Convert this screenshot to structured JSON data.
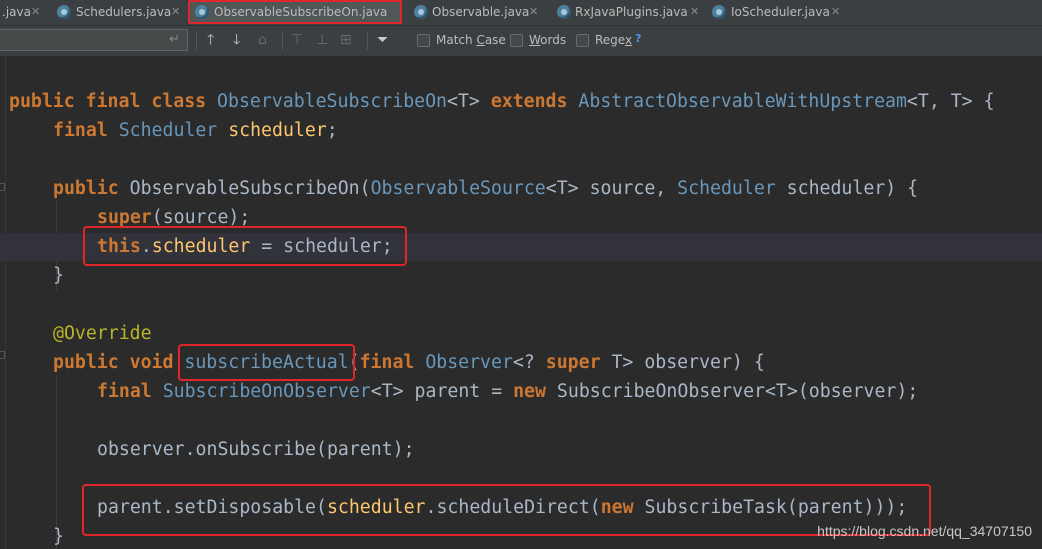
{
  "tabs": [
    {
      "label": ".java",
      "active": false,
      "icon": "java-class-icon"
    },
    {
      "label": "Schedulers.java",
      "active": false,
      "icon": "java-class-icon"
    },
    {
      "label": "ObservableSubscribeOn.java",
      "active": true,
      "icon": "java-class-icon"
    },
    {
      "label": "Observable.java",
      "active": false,
      "icon": "java-class-icon"
    },
    {
      "label": "RxJavaPlugins.java",
      "active": false,
      "icon": "java-class-icon"
    },
    {
      "label": "IoScheduler.java",
      "active": false,
      "icon": "java-class-icon"
    }
  ],
  "tab_close_glyph": "✕",
  "search": {
    "value": "",
    "placeholder": "",
    "options": [
      {
        "label_pre": "Match ",
        "label_u": "C",
        "label_post": "ase",
        "checked": false
      },
      {
        "label_pre": "",
        "label_u": "W",
        "label_post": "ords",
        "checked": false
      },
      {
        "label_pre": "Rege",
        "label_u": "x",
        "label_post": "",
        "checked": false
      }
    ],
    "help": "?"
  },
  "code": {
    "l1": {
      "t1": "public final class ",
      "t2": "ObservableSubscribeOn",
      "t3": "<T> ",
      "t4": "extends ",
      "t5": "AbstractObservableWithUpstream",
      "t6": "<T, T> {"
    },
    "l2": {
      "t1": "final ",
      "t2": "Scheduler ",
      "t3": "scheduler",
      "t4": ";"
    },
    "l3": {
      "t1": "public ",
      "t2": "ObservableSubscribeOn(",
      "t3": "ObservableSource",
      "t4": "<T> source, ",
      "t5": "Scheduler ",
      "t6": "scheduler) {"
    },
    "l4": {
      "t1": "super",
      "t2": "(source);"
    },
    "l5": {
      "t1": "this",
      "t2": ".",
      "t3": "scheduler",
      "t4": " = scheduler;"
    },
    "l6": {
      "t1": "}"
    },
    "l7": {
      "t1": "@Override"
    },
    "l8": {
      "t1": "public void ",
      "t2": "subscribeActual",
      "t3": "(",
      "t4": "final ",
      "t5": "Observer",
      "t6": "<? ",
      "t7": "super ",
      "t8": "T> observer) {"
    },
    "l9": {
      "t1": "final ",
      "t2": "SubscribeOnObserver",
      "t3": "<T> parent = ",
      "t4": "new ",
      "t5": "SubscribeOnObserver<T>(observer);"
    },
    "l10": {
      "t1": "observer.onSubscribe(parent);"
    },
    "l11": {
      "t1": "parent.setDisposable(",
      "t2": "scheduler",
      "t3": ".scheduleDirect(",
      "t4": "new ",
      "t5": "SubscribeTask(parent)));"
    },
    "l12": {
      "t1": "}"
    }
  },
  "watermark": "https://blog.csdn.net/qq_34707150",
  "colors": {
    "keyword": "#cc7832",
    "class_ref": "#6897bb",
    "field": "#ffc66d",
    "annotation": "#bbb529",
    "text": "#a9b7c6",
    "highlight_box": "#e0252b"
  }
}
